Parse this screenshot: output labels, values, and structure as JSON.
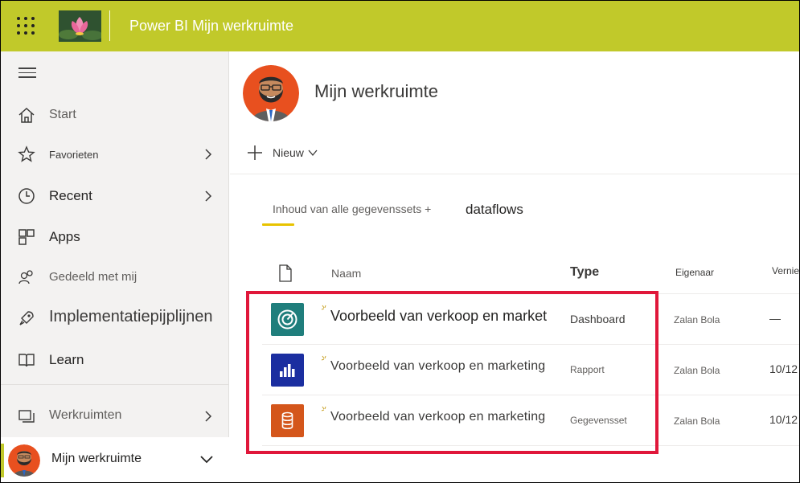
{
  "header": {
    "title": "Power BI Mijn werkruimte"
  },
  "sidebar": {
    "items": [
      {
        "label": "Start"
      },
      {
        "label": "Favorieten"
      },
      {
        "label": "Recent"
      },
      {
        "label": "Apps"
      },
      {
        "label": "Gedeeld met mij"
      },
      {
        "label": "Implementatiepijplijnen"
      },
      {
        "label": "Learn"
      },
      {
        "label": "Werkruimten"
      }
    ],
    "current_workspace": "Mijn werkruimte"
  },
  "workspace": {
    "title": "Mijn werkruimte",
    "new_label": "Nieuw"
  },
  "tabs": [
    {
      "label": "Inhoud van alle gegevenssets +"
    },
    {
      "label": "dataflows"
    }
  ],
  "table": {
    "columns": {
      "name": "Naam",
      "type": "Type",
      "owner": "Eigenaar",
      "modified": "Vernie"
    },
    "rows": [
      {
        "name": "Voorbeeld van verkoop en market",
        "type": "Dashboard",
        "owner": "Zalan Bola",
        "modified": "—",
        "icon": "dashboard-icon",
        "color": "#1f7e7c"
      },
      {
        "name": "Voorbeeld van verkoop en marketing",
        "type": "Rapport",
        "owner": "Zalan Bola",
        "modified": "10/12",
        "icon": "report-icon",
        "color": "#1b2ea0"
      },
      {
        "name": "Voorbeeld van verkoop en marketing",
        "type": "Gegevensset",
        "owner": "Zalan Bola",
        "modified": "10/12",
        "icon": "dataset-icon",
        "color": "#d4561b"
      }
    ]
  },
  "colors": {
    "topbar": "#c1c92a",
    "highlight": "#e0173a",
    "tab_underline": "#e8c300"
  }
}
